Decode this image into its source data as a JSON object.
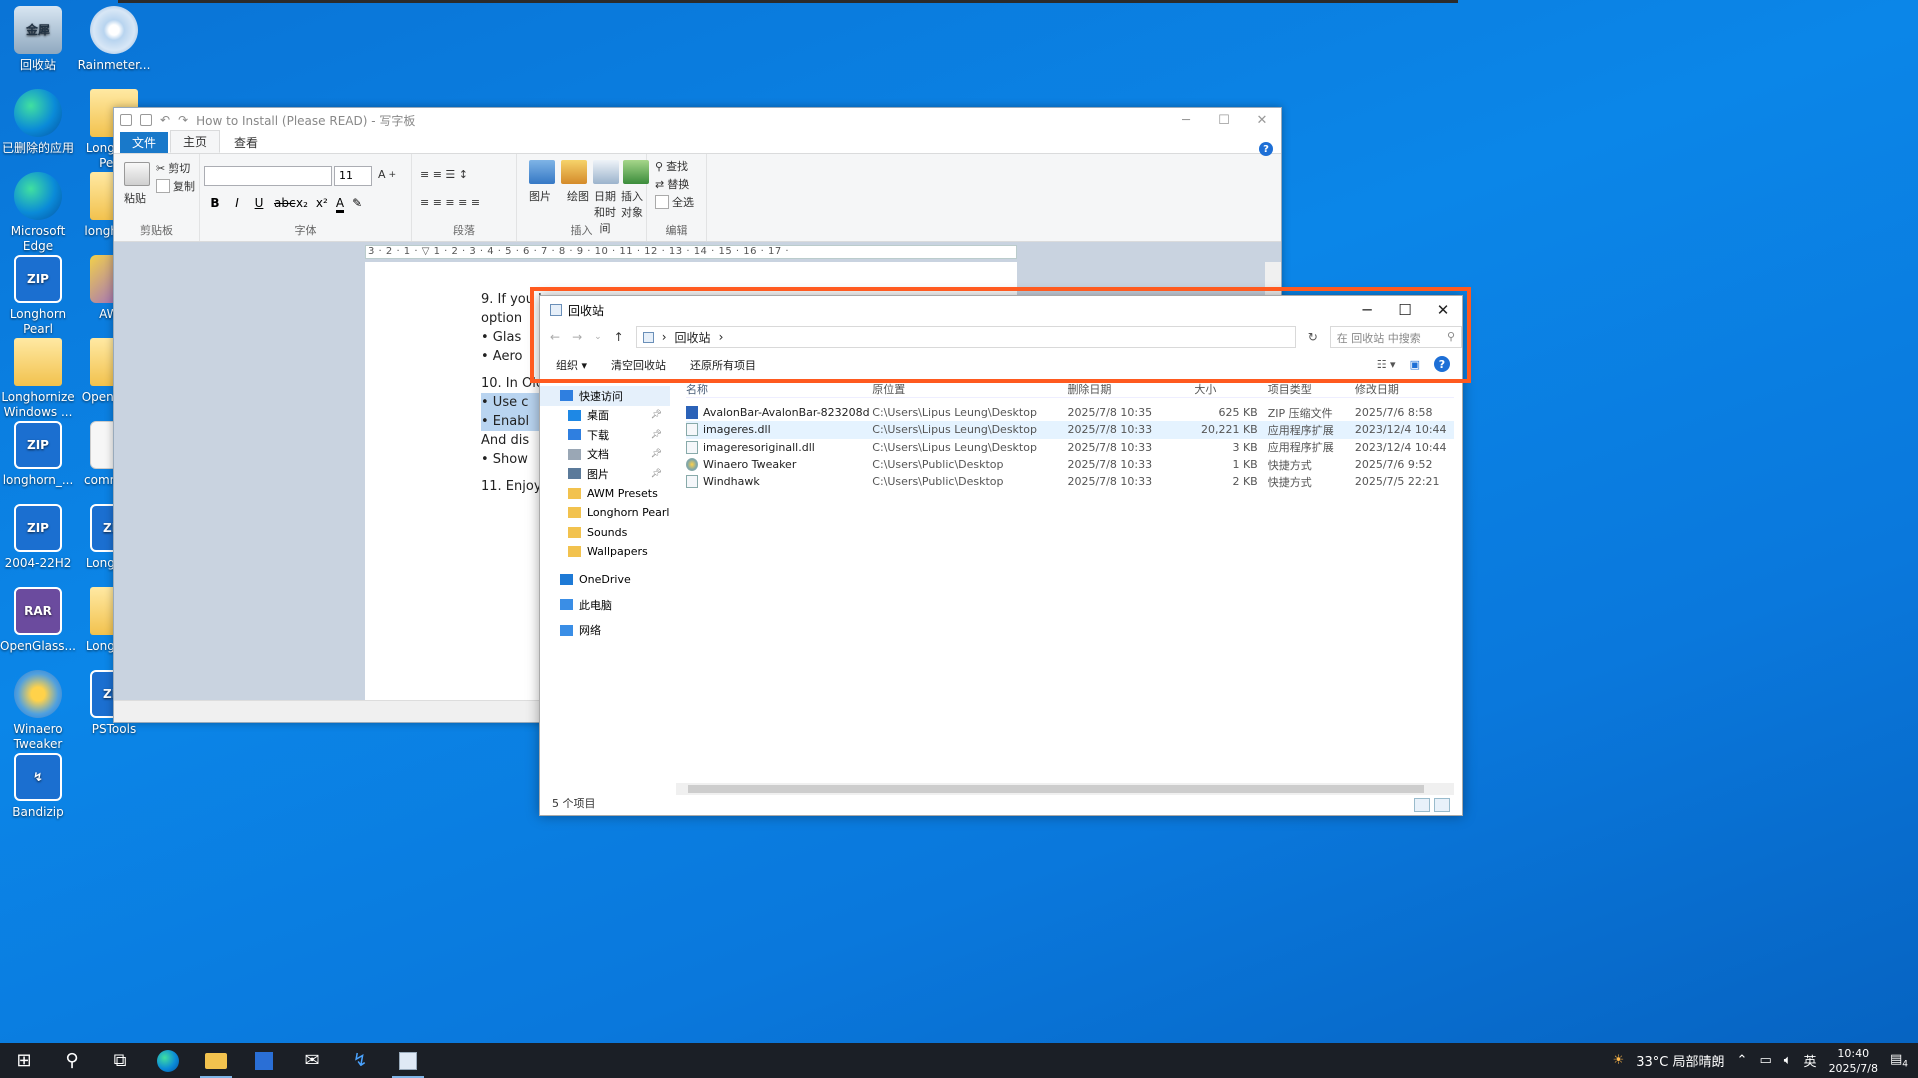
{
  "desktop_icons": [
    {
      "label": "回收站",
      "kind": "bin",
      "glyph": "金犀",
      "icon": "recycle-bin-icon"
    },
    {
      "label": "Rainmeter...",
      "kind": "disc",
      "glyph": "",
      "icon": "rainmeter-icon"
    },
    {
      "label": "已删除的应用",
      "kind": "edge",
      "glyph": "",
      "icon": "edge-icon"
    },
    {
      "label": "Longhorn Pearl",
      "kind": "folder",
      "glyph": "",
      "icon": "folder-icon"
    },
    {
      "label": "Microsoft Edge",
      "kind": "edge",
      "glyph": "",
      "icon": "edge-icon"
    },
    {
      "label": "longhorn_",
      "kind": "folder",
      "glyph": "",
      "icon": "folder-icon"
    },
    {
      "label": "Longhorn Pearl",
      "kind": "zip",
      "glyph": "ZIP",
      "icon": "zip-icon"
    },
    {
      "label": "AWM",
      "kind": "awm",
      "glyph": "",
      "icon": "awm-icon"
    },
    {
      "label": "Longhornize Windows ...",
      "kind": "folder",
      "glyph": "",
      "icon": "folder-icon"
    },
    {
      "label": "OpenGlass",
      "kind": "folder",
      "glyph": "",
      "icon": "folder-icon"
    },
    {
      "label": "longhorn_...",
      "kind": "zip",
      "glyph": "ZIP",
      "icon": "zip-icon"
    },
    {
      "label": "command",
      "kind": "doc",
      "glyph": "",
      "icon": "text-file-icon"
    },
    {
      "label": "2004-22H2",
      "kind": "zip",
      "glyph": "ZIP",
      "icon": "zip-icon"
    },
    {
      "label": "Longhorn",
      "kind": "zip",
      "glyph": "ZIP",
      "icon": "zip-icon"
    },
    {
      "label": "OpenGlass...",
      "kind": "rar",
      "glyph": "RAR",
      "icon": "rar-icon"
    },
    {
      "label": "Longhorn",
      "kind": "folder",
      "glyph": "",
      "icon": "folder-icon"
    },
    {
      "label": "Winaero Tweaker",
      "kind": "tw",
      "glyph": "",
      "icon": "winaero-icon"
    },
    {
      "label": "PSTools",
      "kind": "zip",
      "glyph": "ZIP",
      "icon": "zip-icon"
    },
    {
      "label": "Bandizip",
      "kind": "zip",
      "glyph": "↯",
      "icon": "bandizip-icon"
    }
  ],
  "wordpad": {
    "title": "How to Install (Please READ) - 写字板",
    "tabs": {
      "file": "文件",
      "home": "主页",
      "view": "查看"
    },
    "clipboard": {
      "paste": "粘贴",
      "cut": "剪切",
      "copy": "复制",
      "group": "剪贴板"
    },
    "font": {
      "size": "11",
      "group": "字体"
    },
    "paragraph": {
      "group": "段落"
    },
    "insert": {
      "picture": "图片",
      "paint": "绘图",
      "datetime": "日期和时间",
      "object": "插入对象",
      "group": "插入"
    },
    "edit": {
      "find": "查找",
      "replace": "替换",
      "select_all": "全选",
      "group": "编辑"
    },
    "ruler": "3 · 2 · 1 · ▽ 1 · 2 · 3 · 4 · 5 · 6 · 7 · 8 · 9 · 10 · 11 · 12 · 13 · 14 · 15 · 16 · 17 ·",
    "doc_lines": [
      {
        "text": "9.   If you have",
        "hl": false
      },
      {
        "text": "      option",
        "hl": false
      },
      {
        "text": "      • Glas",
        "hl": false
      },
      {
        "text": "      • Aero",
        "hl": false
      },
      {
        "text": "10. In Old",
        "hl": false
      },
      {
        "text": "      • Use c",
        "hl": true
      },
      {
        "text": "      • Enabl",
        "hl": true
      },
      {
        "text": "      And dis",
        "hl": false
      },
      {
        "text": "      • Show",
        "hl": false
      },
      {
        "text": "11. Enjoy",
        "hl": false
      }
    ]
  },
  "explorer": {
    "title": "回收站",
    "breadcrumb": "回收站",
    "search_placeholder": "在 回收站 中搜索",
    "commands": {
      "organize": "组织 ▾",
      "empty": "清空回收站",
      "restore_all": "还原所有项目"
    },
    "nav": [
      {
        "label": "快速访问",
        "pin": false,
        "indent": 0,
        "sel": true,
        "icon": "star-icon"
      },
      {
        "label": "桌面",
        "pin": true,
        "indent": 1,
        "sel": false,
        "icon": "desktop-icon"
      },
      {
        "label": "下载",
        "pin": true,
        "indent": 1,
        "sel": false,
        "icon": "download-icon"
      },
      {
        "label": "文档",
        "pin": true,
        "indent": 1,
        "sel": false,
        "icon": "documents-icon"
      },
      {
        "label": "图片",
        "pin": true,
        "indent": 1,
        "sel": false,
        "icon": "pictures-icon"
      },
      {
        "label": "AWM Presets",
        "pin": false,
        "indent": 1,
        "sel": false,
        "icon": "folder-icon"
      },
      {
        "label": "Longhorn Pearl",
        "pin": false,
        "indent": 1,
        "sel": false,
        "icon": "folder-icon"
      },
      {
        "label": "Sounds",
        "pin": false,
        "indent": 1,
        "sel": false,
        "icon": "folder-icon"
      },
      {
        "label": "Wallpapers",
        "pin": false,
        "indent": 1,
        "sel": false,
        "icon": "folder-icon"
      },
      {
        "label": "OneDrive",
        "pin": false,
        "indent": 0,
        "sel": false,
        "icon": "onedrive-icon"
      },
      {
        "label": "此电脑",
        "pin": false,
        "indent": 0,
        "sel": false,
        "icon": "computer-icon"
      },
      {
        "label": "网络",
        "pin": false,
        "indent": 0,
        "sel": false,
        "icon": "network-icon"
      }
    ],
    "columns": [
      "名称",
      "原位置",
      "删除日期",
      "大小",
      "项目类型",
      "修改日期"
    ],
    "rows": [
      {
        "name": "AvalonBar-AvalonBar-823208d",
        "location": "C:\\Users\\Lipus Leung\\Desktop",
        "deleted": "2025/7/8 10:35",
        "size": "625 KB",
        "type": "ZIP 压缩文件",
        "modified": "2025/7/6 8:58",
        "icon": "zip"
      },
      {
        "name": "imageres.dll",
        "location": "C:\\Users\\Lipus Leung\\Desktop",
        "deleted": "2025/7/8 10:33",
        "size": "20,221 KB",
        "type": "应用程序扩展",
        "modified": "2023/12/4 10:44",
        "icon": "dll"
      },
      {
        "name": "imageresoriginall.dll",
        "location": "C:\\Users\\Lipus Leung\\Desktop",
        "deleted": "2025/7/8 10:33",
        "size": "3 KB",
        "type": "应用程序扩展",
        "modified": "2023/12/4 10:44",
        "icon": "dll"
      },
      {
        "name": "Winaero Tweaker",
        "location": "C:\\Users\\Public\\Desktop",
        "deleted": "2025/7/8 10:33",
        "size": "1 KB",
        "type": "快捷方式",
        "modified": "2025/7/6 9:52",
        "icon": "tw"
      },
      {
        "name": "Windhawk",
        "location": "C:\\Users\\Public\\Desktop",
        "deleted": "2025/7/8 10:33",
        "size": "2 KB",
        "type": "快捷方式",
        "modified": "2025/7/5 22:21",
        "icon": "lnk"
      }
    ],
    "status": "5 个项目"
  },
  "taskbar": {
    "weather": "33°C  局部晴朗",
    "lang": "英",
    "time": "10:40",
    "date": "2025/7/8",
    "notif": "4"
  }
}
